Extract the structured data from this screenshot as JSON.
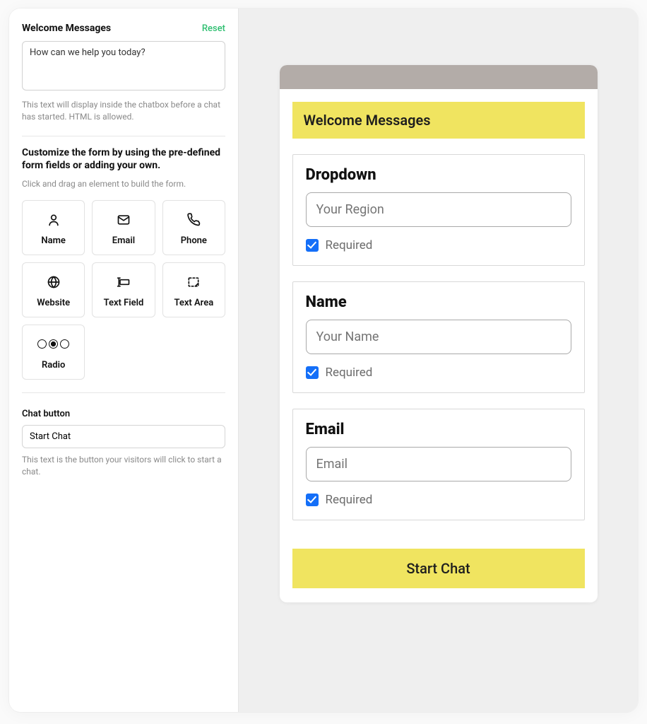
{
  "sidebar": {
    "welcome_section_title": "Welcome Messages",
    "reset_label": "Reset",
    "welcome_textarea_value": "How can we help you today?",
    "welcome_help_text": "This text will display inside the chatbox before a chat has started. HTML is allowed.",
    "customize_heading": "Customize the form by using the pre-defined form fields or adding your own.",
    "customize_subtext": "Click and drag an element to build the form.",
    "fields": [
      {
        "label": "Name"
      },
      {
        "label": "Email"
      },
      {
        "label": "Phone"
      },
      {
        "label": "Website"
      },
      {
        "label": "Text Field"
      },
      {
        "label": "Text Area"
      },
      {
        "label": "Radio"
      }
    ],
    "chat_button_label": "Chat button",
    "chat_button_value": "Start Chat",
    "chat_button_help": "This text is the button your visitors will click to start a chat."
  },
  "preview": {
    "welcome_banner": "Welcome Messages",
    "blocks": [
      {
        "title": "Dropdown",
        "placeholder": "Your Region",
        "required_label": "Required"
      },
      {
        "title": "Name",
        "placeholder": "Your Name",
        "required_label": "Required"
      },
      {
        "title": "Email",
        "placeholder": "Email",
        "required_label": "Required"
      }
    ],
    "start_chat_label": "Start Chat"
  }
}
